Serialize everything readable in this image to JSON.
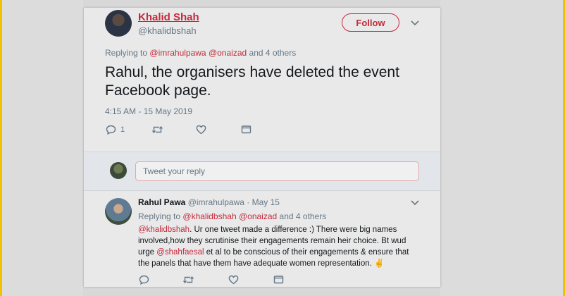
{
  "tweet": {
    "author_name": "Khalid Shah",
    "author_handle": "@khalidbshah",
    "follow_label": "Follow",
    "replying_prefix": "Replying to",
    "replying_mention_1": "@imrahulpawa",
    "replying_mention_2": "@onaizad",
    "replying_suffix": "and 4 others",
    "text": "Rahul, the organisers have deleted the event Facebook page.",
    "timestamp": "4:15 AM - 15 May 2019",
    "reply_count": "1"
  },
  "compose": {
    "placeholder": "Tweet your reply"
  },
  "reply": {
    "author_name": "Rahul Pawa",
    "author_handle": "@imrahulpawa",
    "separator": "·",
    "date": "May 15",
    "replying_prefix": "Replying to",
    "replying_mention_1": "@khalidbshah",
    "replying_mention_2": "@onaizad",
    "replying_suffix": "and 4 others",
    "mention_a": "@khalidbshah",
    "text_a": ". Ur one tweet made a difference :) There were big names involved,how they scrutinise their engagements remain heir choice. Bt wud urge ",
    "mention_b": "@shahfaesal",
    "text_b": " et al to be conscious of their engagements & ensure that the panels that have them have adequate women representation. ",
    "emoji": "✌"
  },
  "icons": {
    "reply": "reply-icon",
    "retweet": "retweet-icon",
    "like": "heart-icon",
    "dm": "envelope-icon",
    "caret": "chevron-down-icon"
  },
  "colors": {
    "accent": "#c5293b",
    "muted_text": "#657786",
    "card_bg": "#e9e9e9",
    "side_border": "#f2c200"
  }
}
